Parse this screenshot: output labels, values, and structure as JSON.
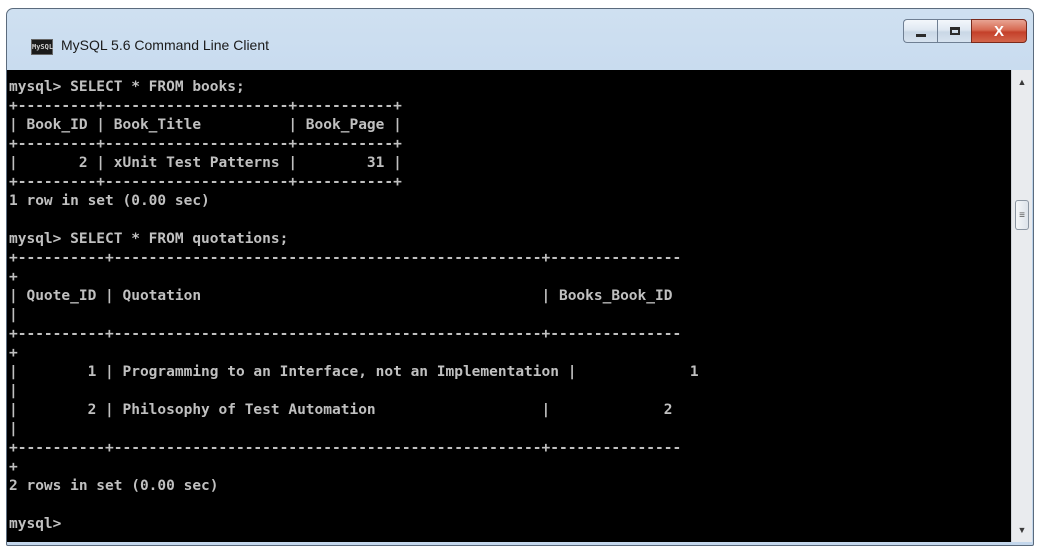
{
  "window": {
    "title": "MySQL 5.6 Command Line Client",
    "icon_text": "MySQL",
    "buttons": {
      "minimize": "minimize",
      "maximize": "maximize",
      "close": "X"
    }
  },
  "console": {
    "lines": [
      "mysql> SELECT * FROM books;",
      "+---------+---------------------+-----------+",
      "| Book_ID | Book_Title          | Book_Page |",
      "+---------+---------------------+-----------+",
      "|       2 | xUnit Test Patterns |        31 |",
      "+---------+---------------------+-----------+",
      "1 row in set (0.00 sec)",
      "",
      "mysql> SELECT * FROM quotations;",
      "+----------+-------------------------------------------------+---------------",
      "+",
      "| Quote_ID | Quotation                                       | Books_Book_ID",
      "|",
      "+----------+-------------------------------------------------+---------------",
      "+",
      "|        1 | Programming to an Interface, not an Implementation |             1",
      "|",
      "|        2 | Philosophy of Test Automation                   |             2",
      "|",
      "+----------+-------------------------------------------------+---------------",
      "+",
      "2 rows in set (0.00 sec)",
      "",
      "mysql>"
    ]
  },
  "scrollbar": {
    "up_icon": "scroll-up-arrow",
    "down_icon": "scroll-down-arrow",
    "thumb_icon": "grip-lines"
  }
}
